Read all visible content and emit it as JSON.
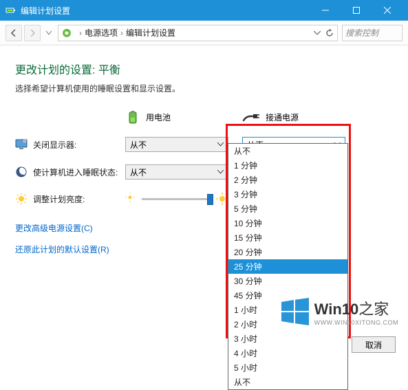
{
  "window": {
    "title": "编辑计划设置"
  },
  "toolbar": {
    "breadcrumb": {
      "root": "电源选项",
      "current": "编辑计划设置"
    },
    "search_placeholder": "搜索控制"
  },
  "page": {
    "heading": "更改计划的设置: 平衡",
    "subheading": "选择希望计算机使用的睡眠设置和显示设置。"
  },
  "columns": {
    "battery": "用电池",
    "plugged": "接通电源"
  },
  "rows": {
    "display_off": {
      "label": "关闭显示器:",
      "battery_val": "从不",
      "plugged_val": "从不"
    },
    "sleep": {
      "label": "使计算机进入睡眠状态:",
      "battery_val": "从不"
    },
    "brightness": {
      "label": "调整计划亮度:"
    }
  },
  "dropdown_options": [
    "从不",
    "1 分钟",
    "2 分钟",
    "3 分钟",
    "5 分钟",
    "10 分钟",
    "15 分钟",
    "20 分钟",
    "25 分钟",
    "30 分钟",
    "45 分钟",
    "1 小时",
    "2 小时",
    "3 小时",
    "4 小时",
    "5 小时",
    "从不"
  ],
  "dropdown_selected": "25 分钟",
  "links": {
    "advanced": "更改高级电源设置(C)",
    "restore": "还原此计划的默认设置(R)"
  },
  "buttons": {
    "cancel": "取消"
  },
  "watermark": {
    "brand": "Win10",
    "suffix": "之家",
    "url": "WWW.WIN10XITONG.COM"
  },
  "colors": {
    "accent": "#1e90d8",
    "heading": "#0a6a3a",
    "link": "#0066cc",
    "highlight_border": "#e11"
  }
}
